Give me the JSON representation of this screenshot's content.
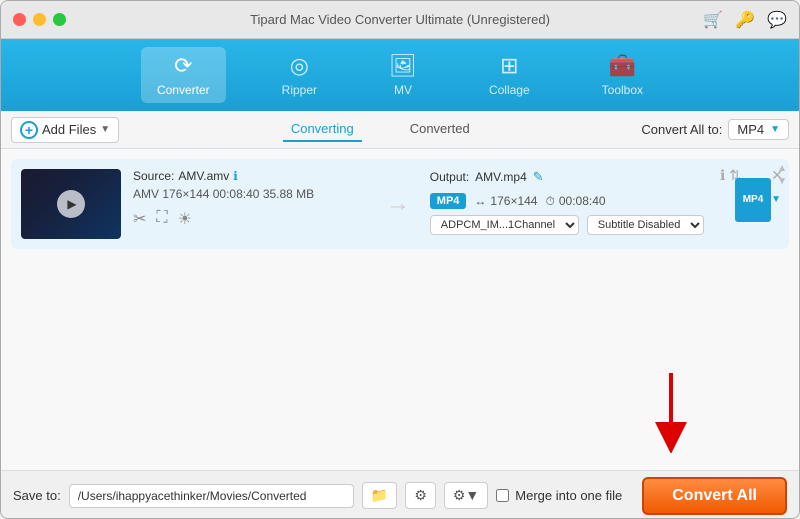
{
  "app": {
    "title": "Tipard Mac Video Converter Ultimate (Unregistered)"
  },
  "nav": {
    "items": [
      {
        "id": "converter",
        "label": "Converter",
        "active": true
      },
      {
        "id": "ripper",
        "label": "Ripper",
        "active": false
      },
      {
        "id": "mv",
        "label": "MV",
        "active": false
      },
      {
        "id": "collage",
        "label": "Collage",
        "active": false
      },
      {
        "id": "toolbox",
        "label": "Toolbox",
        "active": false
      }
    ]
  },
  "toolbar": {
    "add_files_label": "Add Files",
    "tabs": [
      {
        "id": "converting",
        "label": "Converting",
        "active": true
      },
      {
        "id": "converted",
        "label": "Converted",
        "active": false
      }
    ],
    "convert_all_to_label": "Convert All to:",
    "convert_all_to_value": "MP4"
  },
  "file_item": {
    "source_label": "Source:",
    "source_file": "AMV.amv",
    "output_label": "Output:",
    "output_file": "AMV.mp4",
    "format": "AMV",
    "width": "176",
    "height": "144",
    "duration": "00:08:40",
    "size": "35.88 MB",
    "output_format": "MP4",
    "output_width": "176",
    "output_height": "144",
    "output_duration": "00:08:40",
    "audio_codec": "ADPCM_IM...1Channel",
    "subtitle": "Subtitle Disabled",
    "format_badge": "MP4"
  },
  "bottom_bar": {
    "save_to_label": "Save to:",
    "save_path": "/Users/ihappyacethinker/Movies/Converted",
    "merge_label": "Merge into one file",
    "convert_all_label": "Convert All"
  }
}
